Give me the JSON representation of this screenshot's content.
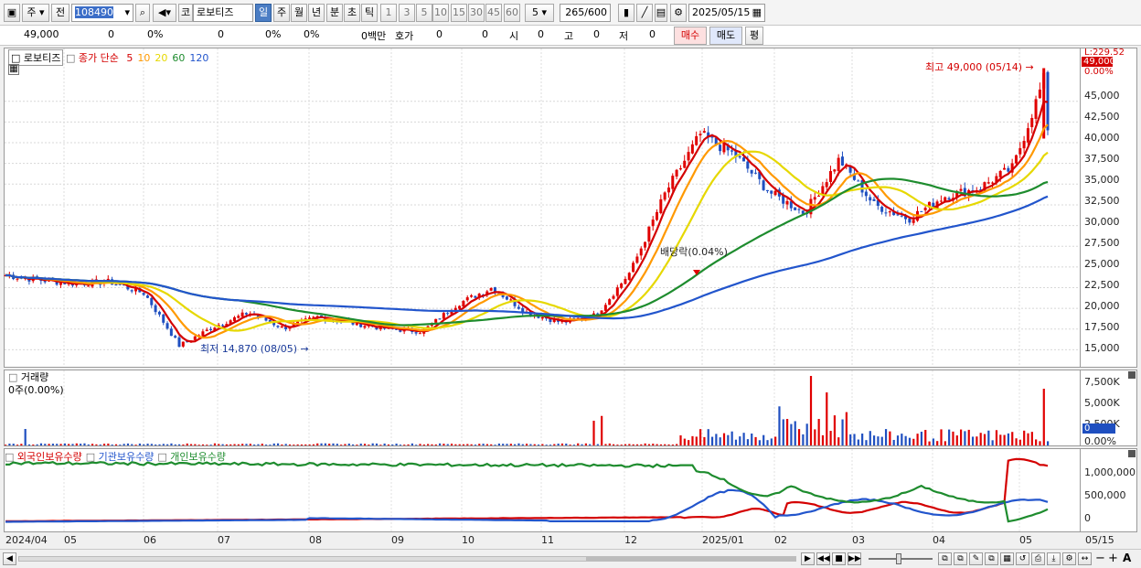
{
  "toolbar": {
    "period_main": "주",
    "prev_label": "전",
    "code": "108490",
    "market_badge": "코",
    "stock_name": "로보티즈",
    "period_buttons": [
      "일",
      "주",
      "월",
      "년",
      "분",
      "초",
      "틱"
    ],
    "interval_buttons": [
      "1",
      "3",
      "5",
      "10",
      "15",
      "30",
      "45",
      "60"
    ],
    "interval_select": "5",
    "count_current": "265",
    "count_total": "/600",
    "date": "2025/05/15"
  },
  "infobar": {
    "price": "49,000",
    "change": "0",
    "change_pct": "0%",
    "volume": "0",
    "vol_pct": "0%",
    "pct3": "0%",
    "amount": "0백만",
    "quote_label": "호가",
    "quote1": "0",
    "quote2": "0",
    "open_label": "시",
    "open": "0",
    "high_label": "고",
    "high": "0",
    "low_label": "저",
    "low": "0",
    "buy": "매수",
    "sell": "매도",
    "avg": "평"
  },
  "price_panel": {
    "stock_label": "로보티즈",
    "legend_prefix": "종가 단순",
    "ma_labels": [
      "5",
      "10",
      "20",
      "60",
      "120"
    ],
    "ma_colors": [
      "#d40000",
      "#ff9900",
      "#e6d800",
      "#1e8c2e",
      "#2255cc"
    ],
    "high_annotation": "최고 49,000 (05/14)",
    "low_annotation": "최저 14,870 (08/05)",
    "dividend_annotation": "배당락(0.04%)",
    "scale_top": "L:229.52",
    "current_price_tag": "49,000",
    "pct_tag": "0.00%",
    "y_ticks": [
      "45,000",
      "42,500",
      "40,000",
      "37,500",
      "35,000",
      "32,500",
      "30,000",
      "27,500",
      "25,000",
      "22,500",
      "20,000",
      "17,500",
      "15,000"
    ]
  },
  "volume_panel": {
    "title": "거래량",
    "value": "0주(0.00%)",
    "y_ticks": [
      "7,500K",
      "5,000K",
      "2,500K",
      "0.00%"
    ],
    "current_tag": "0"
  },
  "holdings_panel": {
    "legend": [
      "외국인보유수량",
      "기관보유수량",
      "개인보유수량"
    ],
    "legend_colors": [
      "#d40000",
      "#2255cc",
      "#1e8c2e"
    ],
    "y_ticks": [
      "1,000,000",
      "500,000",
      "0"
    ]
  },
  "x_axis": {
    "labels": [
      "2024/04",
      "05",
      "06",
      "07",
      "08",
      "09",
      "10",
      "11",
      "12",
      "2025/01",
      "02",
      "03",
      "04",
      "05",
      "05/15"
    ]
  },
  "chart_data": {
    "type": "candlestick",
    "y_range": [
      13500,
      49500
    ],
    "ohlc_close_samples": [
      [
        "2024/04",
        24000
      ],
      [
        "2024/05",
        23400
      ],
      [
        "2024/06",
        23000
      ],
      [
        "2024/07",
        23200
      ],
      [
        "2024/07",
        21800
      ],
      [
        "2024/08",
        15500
      ],
      [
        "2024/08",
        17800
      ],
      [
        "2024/09",
        19500
      ],
      [
        "2024/09",
        17600
      ],
      [
        "2024/10",
        19000
      ],
      [
        "2024/10",
        18200
      ],
      [
        "2024/11",
        17500
      ],
      [
        "2024/11",
        17200
      ],
      [
        "2024/11",
        20500
      ],
      [
        "2024/12",
        22500
      ],
      [
        "2024/12",
        19500
      ],
      [
        "2024/12",
        18300
      ],
      [
        "2024/12",
        19200
      ],
      [
        "2025/01",
        24500
      ],
      [
        "2025/01",
        34000
      ],
      [
        "2025/02",
        41000
      ],
      [
        "2025/02",
        38500
      ],
      [
        "2025/03",
        34000
      ],
      [
        "2025/03",
        31500
      ],
      [
        "2025/03",
        38000
      ],
      [
        "2025/04",
        32500
      ],
      [
        "2025/04",
        30800
      ],
      [
        "2025/04",
        33500
      ],
      [
        "2025/05",
        34500
      ],
      [
        "2025/05",
        37000
      ],
      [
        "2025/05",
        49000
      ]
    ],
    "high": {
      "value": 49000,
      "date": "05/14"
    },
    "low": {
      "value": 14870,
      "date": "08/05"
    }
  }
}
